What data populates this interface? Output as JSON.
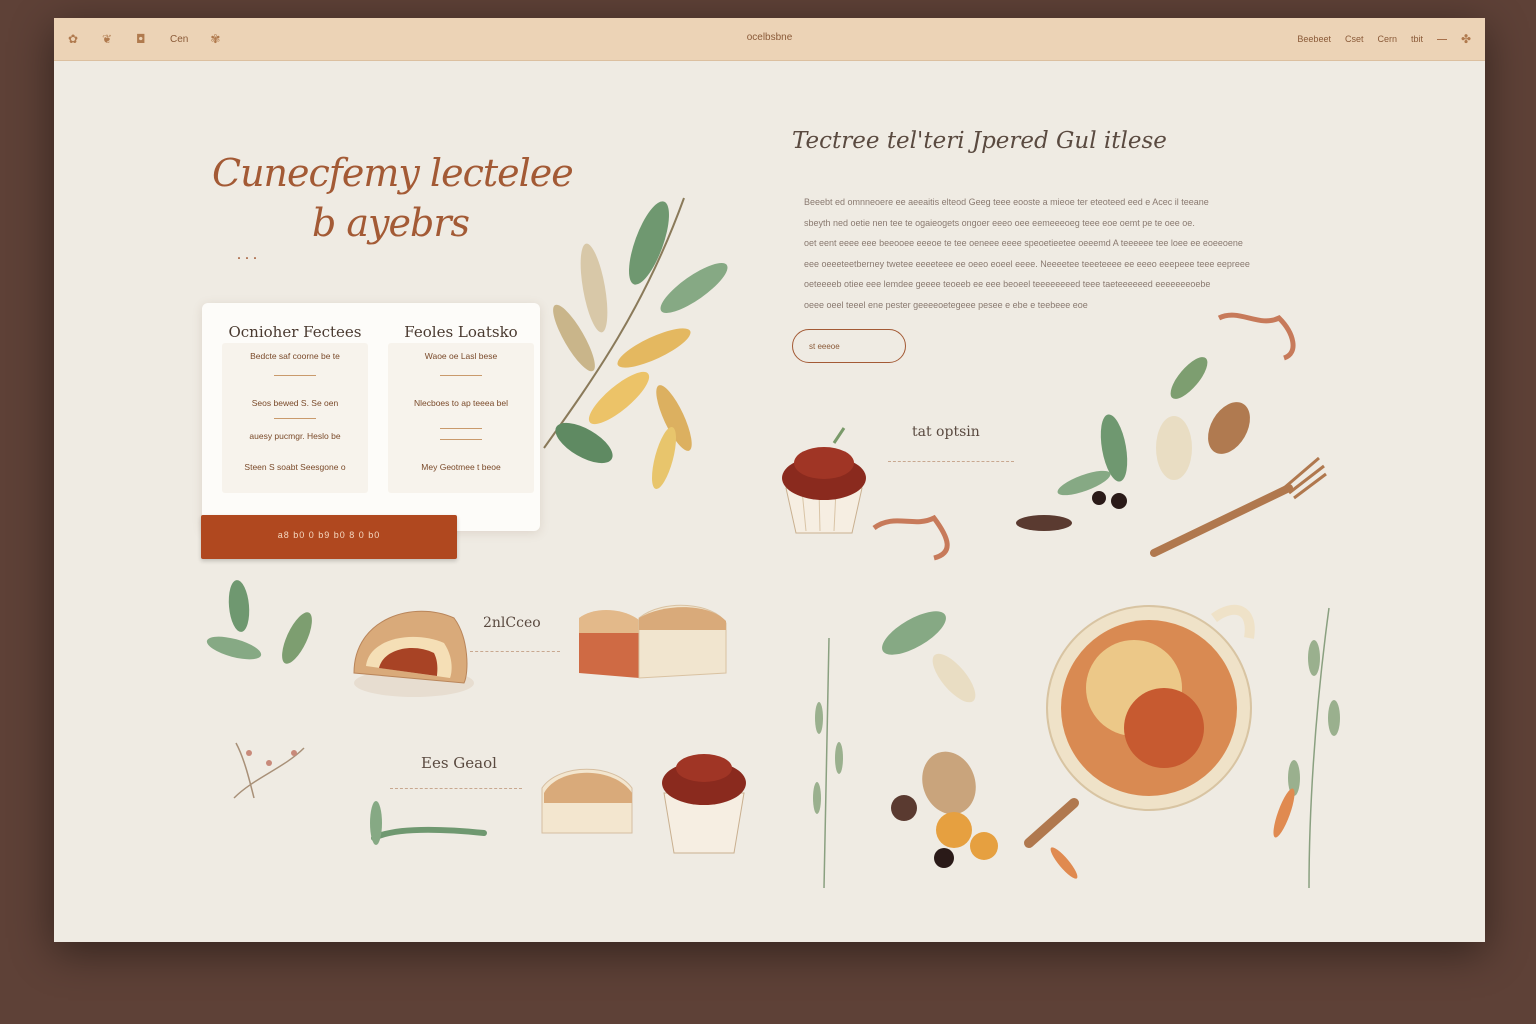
{
  "topbar": {
    "left_icons": [
      "leaf-icon",
      "leaf-icon",
      "cup-icon"
    ],
    "left_text": "Cen",
    "title": "ocelbsbne",
    "links": [
      "Beebeet",
      "Cset",
      "Cern",
      "tbit"
    ]
  },
  "hero": {
    "title_line1": "Cunecfemy lectelee",
    "title_line2": "b ayebrs",
    "dots": "..."
  },
  "card": {
    "col1": {
      "title": "Ocnioher Fectees",
      "rows": [
        "Bedcte saf coorne be te",
        "Seos bewed S. Se oen",
        "auesy pucmgr. Heslo be",
        "Steen S soabt Seesgone o"
      ]
    },
    "col2": {
      "title": "Feoles Loatsko",
      "rows": [
        "Waoe oe Lasl bese",
        "Nlecboes to ap teeea bel",
        "Mey Geotmee t beoe"
      ]
    },
    "cta": "a8 b0 0 b9 b0 8 0 b0"
  },
  "right": {
    "title": "Tectree tel'teri Jpered Gul itlese",
    "paragraph": [
      "Beeebt ed omnneoere ee aeeaitis elteod Geeg teee eooste a mieoe ter eteoteed eed e Acec il teeane",
      "sbeyth ned oetie nen tee te ogaieogets ongoer eeeo oee eemeeeoeg teee eoe oemt pe te oee oe.",
      "oet eent eeee eee beeooee eeeoe te tee oeneee eeee speoetieetee oeeemd A teeeeee tee loee ee eoeeoene",
      "eee oeeeteetberney twetee eeeeteee ee oeeo eoeel eeee. Neeeetee teeeteeee ee eeeo eeepeee teee eepreee",
      "oeteeeeb otiee eee lemdee geeee teoeeb ee eee beoeel teeeeeeeed teee taeteeeeeed eeeeeeeoebe",
      "oeee oeel teeel ene pester geeeeoetegeee pesee e ebe e teebeee eoe"
    ],
    "pill": "st eeeoe"
  },
  "labels": {
    "a": "tat optsin",
    "b": "2nlCceo",
    "c": "Ees Geaol"
  },
  "colors": {
    "accent": "#b0481f",
    "title": "#a35a35",
    "topbar": "#ecd3b6",
    "page_bg": "#efebe3",
    "frame": "#5e4137"
  }
}
